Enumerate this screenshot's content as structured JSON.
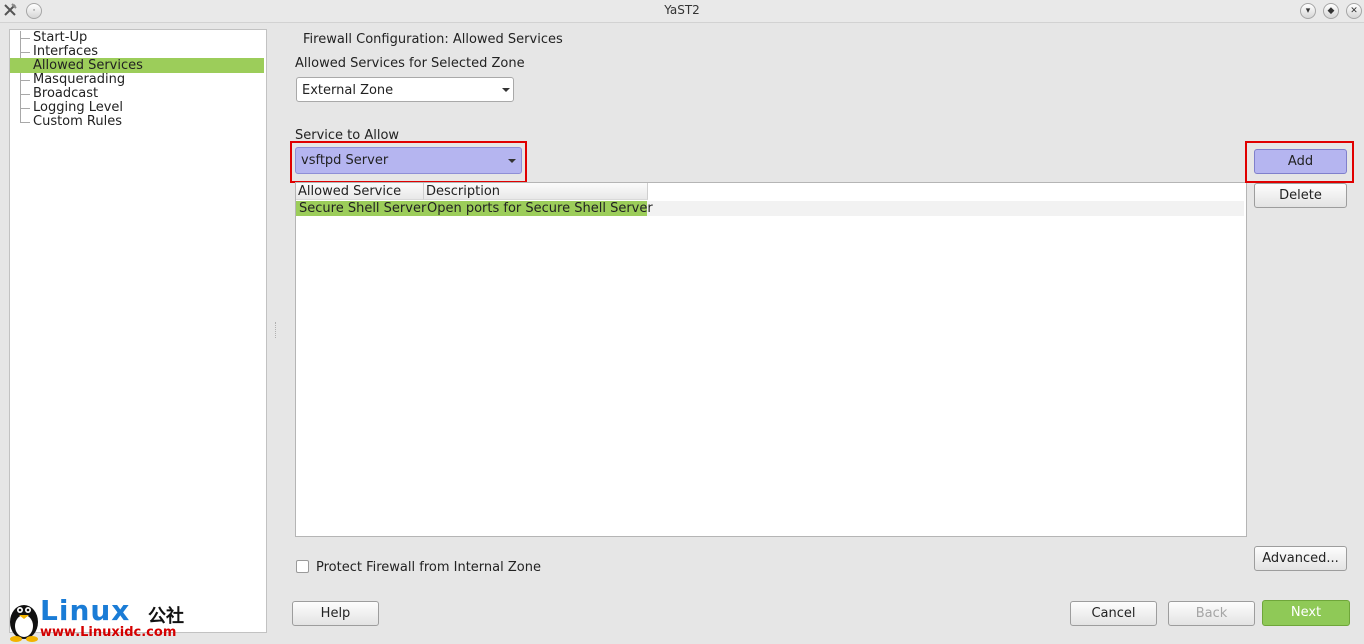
{
  "window": {
    "title": "YaST2"
  },
  "sidebar": {
    "items": [
      {
        "label": "Start-Up",
        "selected": false
      },
      {
        "label": "Interfaces",
        "selected": false
      },
      {
        "label": "Allowed Services",
        "selected": true
      },
      {
        "label": "Masquerading",
        "selected": false
      },
      {
        "label": "Broadcast",
        "selected": false
      },
      {
        "label": "Logging Level",
        "selected": false
      },
      {
        "label": "Custom Rules",
        "selected": false
      }
    ]
  },
  "main": {
    "heading": "Firewall Configuration: Allowed Services",
    "zone_label": "Allowed Services for Selected Zone",
    "zone_value": "External Zone",
    "service_label": "Service to Allow",
    "service_value": "vsftpd Server",
    "table": {
      "columns": [
        "Allowed Service",
        "Description"
      ],
      "rows": [
        [
          "Secure Shell Server",
          "Open ports for Secure Shell Server"
        ]
      ]
    },
    "protect_checkbox_label": "Protect Firewall from Internal Zone",
    "protect_checked": false
  },
  "buttons": {
    "add": "Add",
    "delete": "Delete",
    "advanced": "Advanced...",
    "help": "Help",
    "cancel": "Cancel",
    "back": "Back",
    "next": "Next"
  },
  "watermark": {
    "brand": "Linux",
    "suffix": "公社",
    "url": "www.Linuxidc.com"
  },
  "colors": {
    "selection": "#9ccd5a",
    "highlight_box": "#e00000",
    "accent_combo": "#b5b5f0",
    "next_button": "#8fc957"
  }
}
